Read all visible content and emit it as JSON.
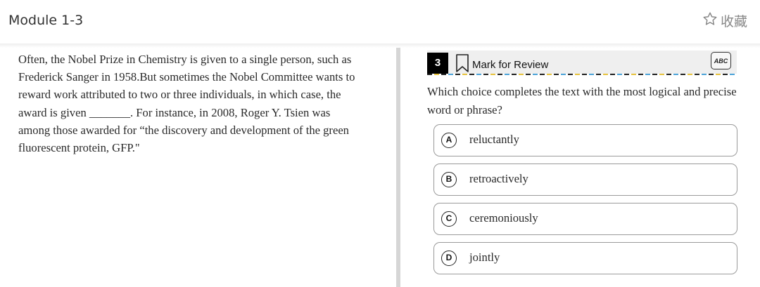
{
  "header": {
    "module_title": "Module 1-3",
    "collect_label": "收藏",
    "collect_icon": "star-outline-icon"
  },
  "passage": {
    "lines": [
      "Often, the Nobel Prize in Chemistry is given to a single person, such as",
      "Frederick Sanger in 1958.But sometimes the Nobel Committee wants to",
      "reward work attributed to two or three individuals, in which case, the",
      "award is given _______. For instance, in 2008, Roger Y. Tsien was",
      "among those awarded for “the discovery and development of the green",
      "fluorescent protein, GFP.\""
    ]
  },
  "question": {
    "number": "3",
    "mark_label": "Mark for Review",
    "bookmark_icon": "bookmark-icon",
    "abc_label": "ABC",
    "abc_icon": "abc-strikethrough-icon",
    "prompt": "Which choice completes the text with the most logical and precise word or phrase?",
    "choices": [
      {
        "letter": "A",
        "text": "reluctantly"
      },
      {
        "letter": "B",
        "text": "retroactively"
      },
      {
        "letter": "C",
        "text": "ceremoniously"
      },
      {
        "letter": "D",
        "text": "jointly"
      }
    ]
  },
  "colors": {
    "accent_yellow": "#e7c23c",
    "accent_blue": "#4aa3d8",
    "divider": "#d6d6d6"
  }
}
